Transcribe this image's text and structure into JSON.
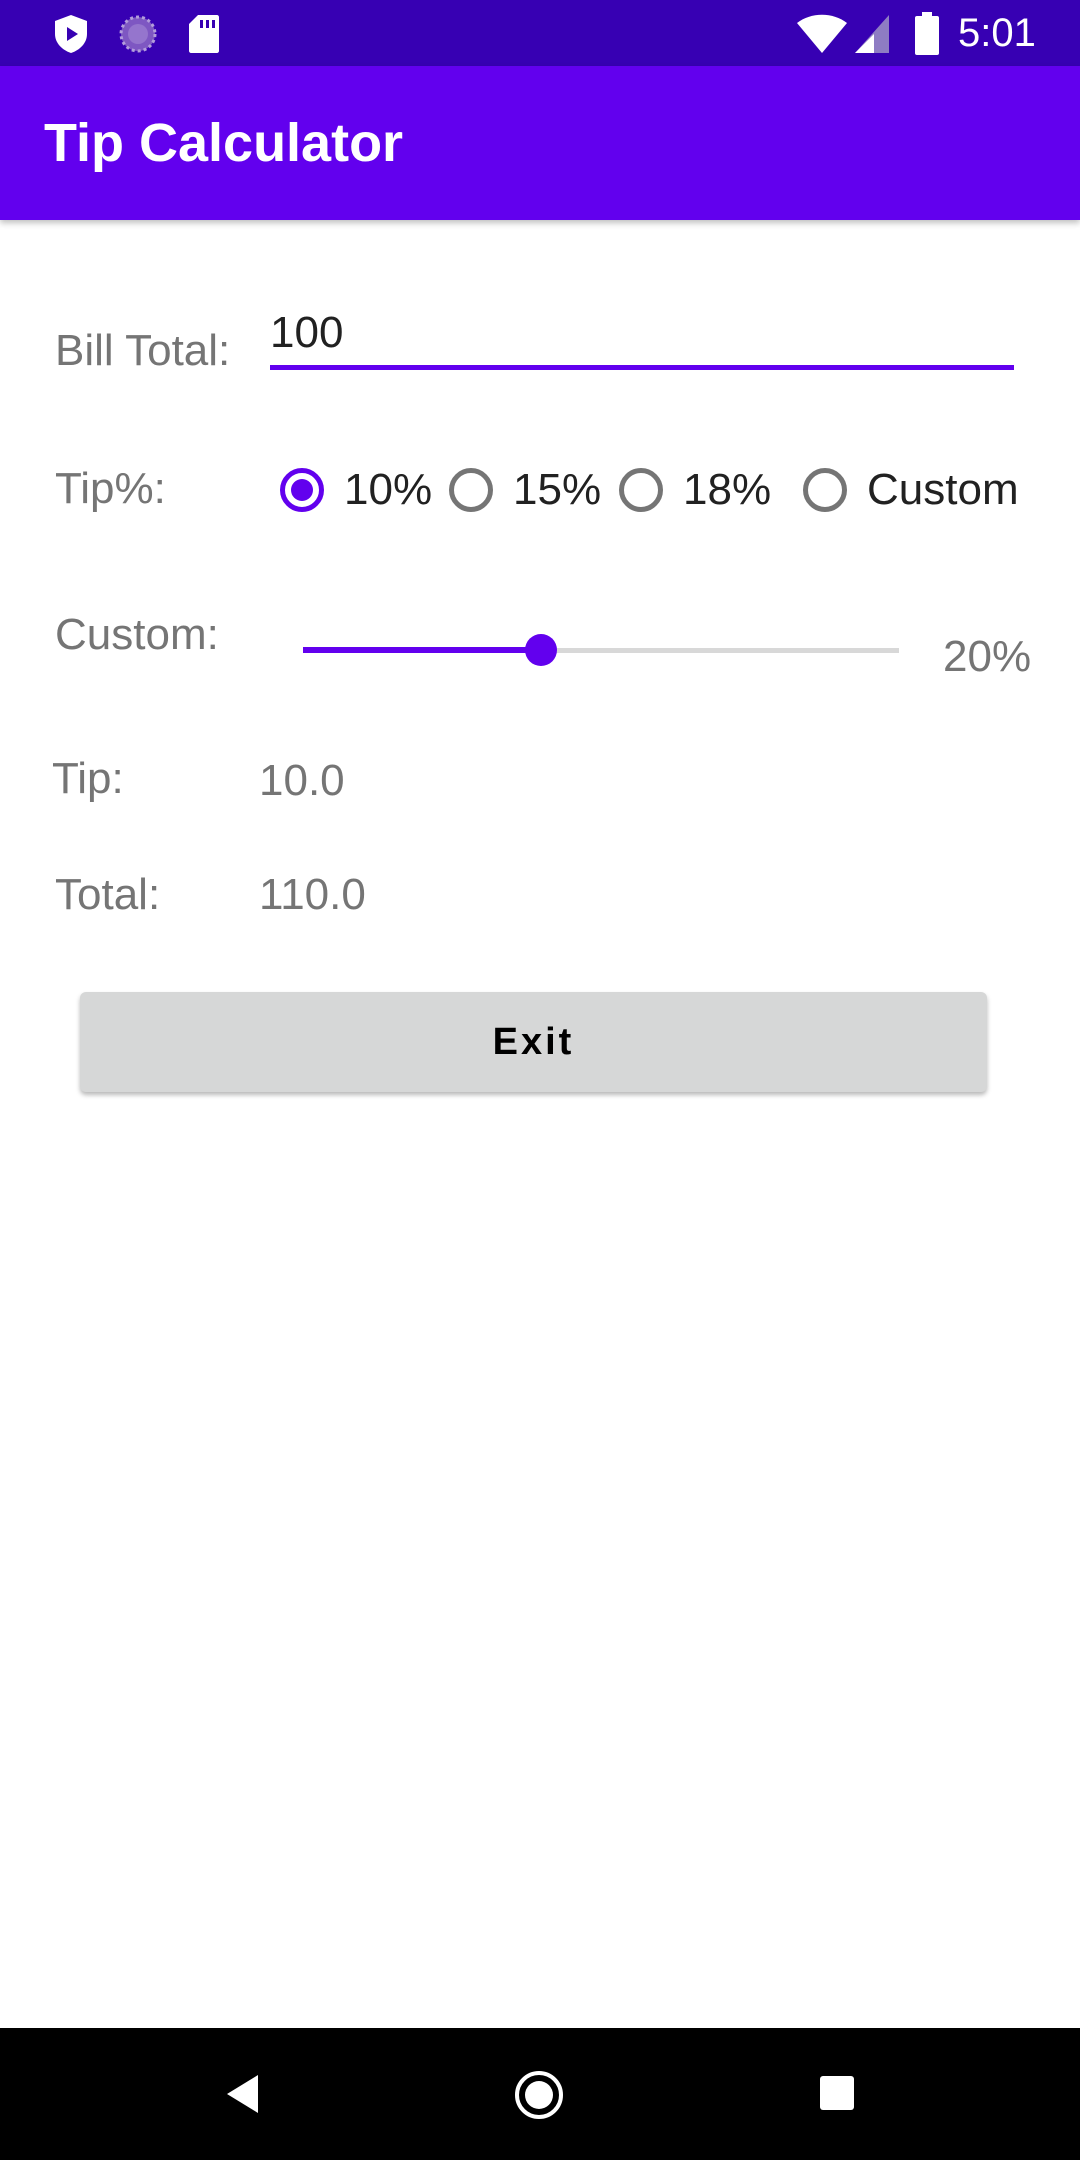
{
  "status_bar": {
    "time": "5:01",
    "left_icons": [
      "shield-play-icon",
      "loading-spinner-icon",
      "sd-card-icon"
    ],
    "right_icons": [
      "wifi-icon",
      "signal-icon",
      "battery-icon"
    ]
  },
  "app_bar": {
    "title": "Tip Calculator"
  },
  "bill": {
    "label": "Bill Total:",
    "value": "100"
  },
  "tip_percent": {
    "label": "Tip%:",
    "options": [
      {
        "label": "10%",
        "checked": true
      },
      {
        "label": "15%",
        "checked": false
      },
      {
        "label": "18%",
        "checked": false
      },
      {
        "label": "Custom",
        "checked": false
      }
    ]
  },
  "custom": {
    "label": "Custom:",
    "value_text": "20%",
    "slider_fraction": 0.4
  },
  "results": {
    "tip_label": "Tip:",
    "tip_value": "10.0",
    "total_label": "Total:",
    "total_value": "110.0"
  },
  "exit_button": {
    "label": "Exit"
  },
  "nav_bar": {
    "icons": [
      "back-icon",
      "home-icon",
      "recents-icon"
    ]
  },
  "colors": {
    "accent": "#6200ee",
    "status_bar": "#3700b3",
    "button": "#d6d7d7"
  }
}
